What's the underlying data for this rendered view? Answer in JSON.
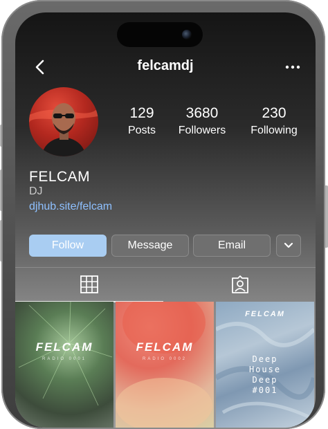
{
  "header": {
    "username": "felcamdj"
  },
  "stats": [
    {
      "value": "129",
      "label": "Posts"
    },
    {
      "value": "3680",
      "label": "Followers"
    },
    {
      "value": "230",
      "label": "Following"
    }
  ],
  "profile": {
    "name": "FELCAM",
    "role": "DJ",
    "link": "djhub.site/felcam"
  },
  "actions": {
    "follow": "Follow",
    "message": "Message",
    "email": "Email"
  },
  "posts": [
    {
      "brand": "FELCAM",
      "subtitle": "RADIO 0001"
    },
    {
      "brand": "FELCAM",
      "subtitle": "RADIO 0002"
    },
    {
      "brand": "FELCAM",
      "lines": [
        "Deep",
        "House",
        "Deep",
        "#001"
      ]
    }
  ],
  "colors": {
    "link": "#8ec0ff",
    "follow_button": "#a9cdf2"
  },
  "icons": [
    "back-arrow-icon",
    "more-dots-icon",
    "chevron-down-icon",
    "grid-icon",
    "tagged-person-icon"
  ]
}
